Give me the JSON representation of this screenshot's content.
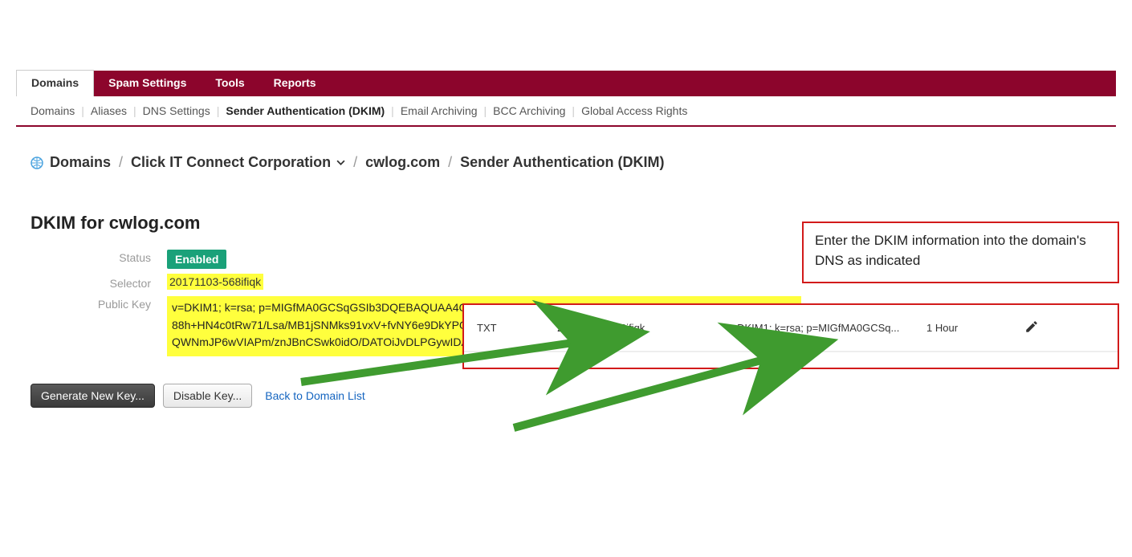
{
  "nav": {
    "tabs": [
      "Domains",
      "Spam Settings",
      "Tools",
      "Reports"
    ],
    "active_index": 0
  },
  "subnav": {
    "items": [
      "Domains",
      "Aliases",
      "DNS Settings",
      "Sender Authentication (DKIM)",
      "Email Archiving",
      "BCC Archiving",
      "Global Access Rights"
    ],
    "active_index": 3
  },
  "breadcrumb": {
    "root": "Domains",
    "org": "Click IT Connect Corporation",
    "domain": "cwlog.com",
    "page": "Sender Authentication (DKIM)"
  },
  "page": {
    "title": "DKIM for cwlog.com"
  },
  "dkim": {
    "status_label": "Status",
    "status_badge": "Enabled",
    "selector_label": "Selector",
    "selector_value": "20171103-568ifiqk",
    "publickey_label": "Public Key",
    "publickey_value": "v=DKIM1; k=rsa; p=MIGfMA0GCSqGSIb3DQEBAQUAA4GNADCBiQKBgQCVH+hXx8RDFXomyNBVcQnUyP4Kk7pkeSyFA88h+HN4c0tRw71/Lsa/MB1jSNMks91vxV+fvNY6e9DkYPGGXKH2uCYjsvnO3Q6Jqv3nH91udT9Fmi6p82tszq3GIp/gS2WZNQWNmJP6wVIAPm/znJBnCSwk0idO/DATOiJvDLPGywIDAQAB"
  },
  "buttons": {
    "generate": "Generate New Key...",
    "disable": "Disable Key...",
    "backlink": "Back to Domain List"
  },
  "annotation": {
    "text": "Enter the DKIM information into the domain's DNS as indicated"
  },
  "dns_record": {
    "type": "TXT",
    "name": "20171103−568ifiqk",
    "value": "v=DKIM1; k=rsa; p=MIGfMA0GCSq...",
    "ttl": "1 Hour"
  },
  "colors": {
    "brand": "#8c052c",
    "success": "#1aa179",
    "highlight": "#ffff3d",
    "callout": "#d21a1a",
    "arrow": "#3f9b2f"
  }
}
